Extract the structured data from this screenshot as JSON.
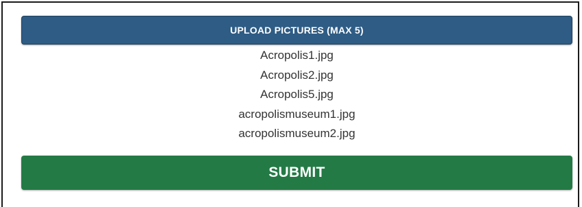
{
  "upload": {
    "label": "UPLOAD PICTURES (MAX 5)"
  },
  "files": [
    "Acropolis1.jpg",
    "Acropolis2.jpg",
    "Acropolis5.jpg",
    "acropolismuseum1.jpg",
    "acropolismuseum2.jpg"
  ],
  "submit": {
    "label": "SUBMIT"
  },
  "colors": {
    "upload_button": "#2e5c85",
    "submit_button": "#237a45",
    "text": "#333333",
    "border": "#1a1a1a"
  }
}
